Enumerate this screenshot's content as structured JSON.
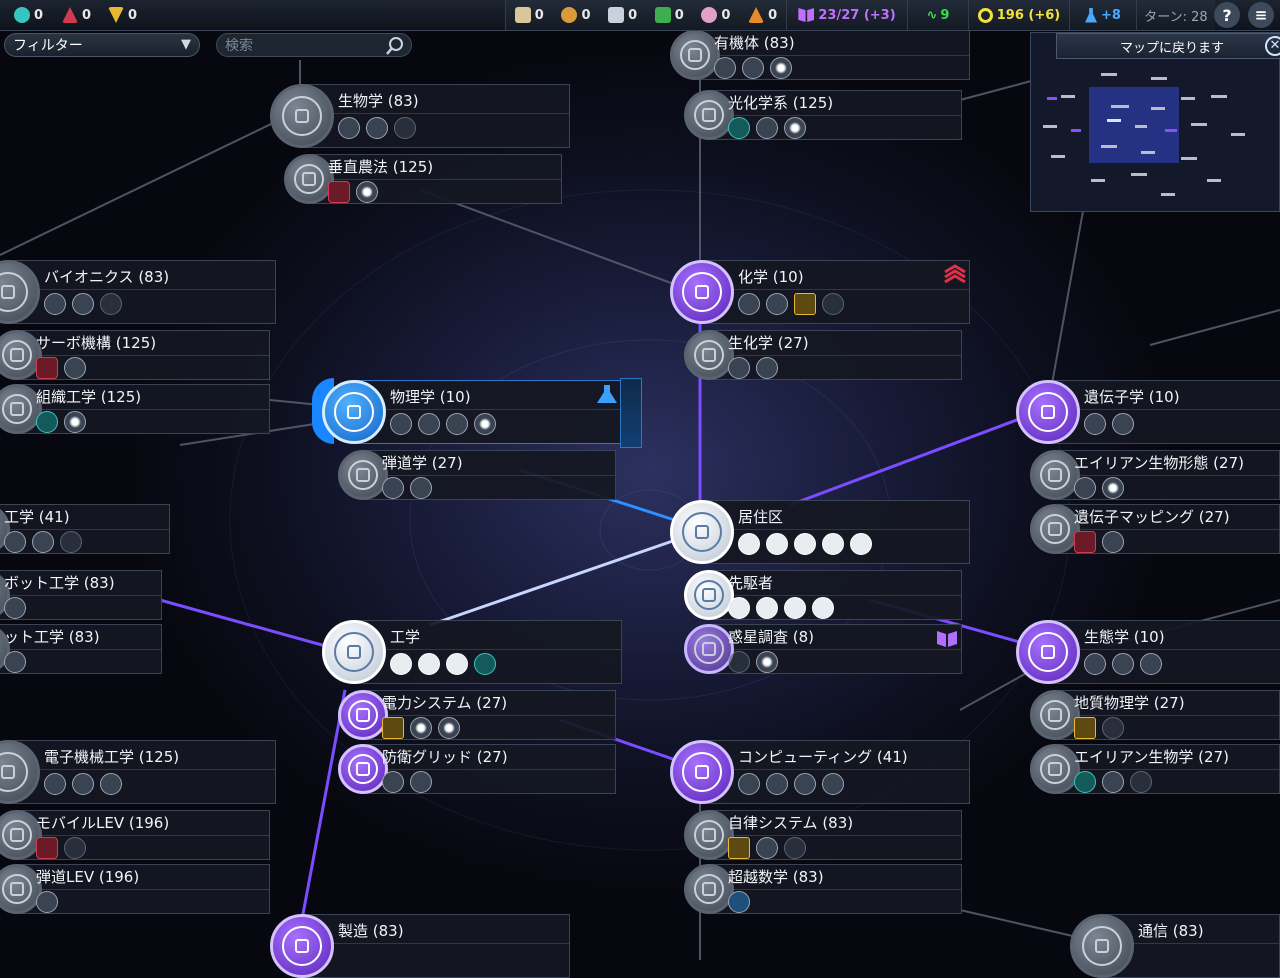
{
  "top_bar": {
    "left_resources": [
      {
        "icon": "teal-resource-icon",
        "value": "0",
        "color": "#36c6c1"
      },
      {
        "icon": "red-resource-icon",
        "value": "0",
        "color": "#d23a52"
      },
      {
        "icon": "gold-resource-icon",
        "value": "0",
        "color": "#e8b832"
      }
    ],
    "strategic_resources": [
      {
        "icon": "firaxite-icon",
        "value": "0"
      },
      {
        "icon": "floatstone-icon",
        "value": "0"
      },
      {
        "icon": "titanium-icon",
        "value": "0"
      },
      {
        "icon": "geothermal-icon",
        "value": "0"
      },
      {
        "icon": "xenomass-icon",
        "value": "0"
      },
      {
        "icon": "oil-icon",
        "value": "0"
      }
    ],
    "science": "23/27 (+3)",
    "health": "9",
    "energy": "196 (+6)",
    "culture": "+8",
    "turn": "ターン: 28",
    "help": "?",
    "menu": "≡"
  },
  "filter": {
    "label": "フィルター"
  },
  "search": {
    "placeholder": "検索"
  },
  "minimap": {
    "title": "マップに戻ります"
  },
  "techs": {
    "organic": {
      "name": "有機体 (83)"
    },
    "photochem": {
      "name": "光化学系 (125)"
    },
    "biology": {
      "name": "生物学 (83)"
    },
    "vertical_farming": {
      "name": "垂直農法 (125)"
    },
    "bionics": {
      "name": "バイオニクス (83)"
    },
    "servo": {
      "name": "サーボ機構 (125)"
    },
    "tissue": {
      "name": "組織工学 (125)"
    },
    "chemistry": {
      "name": "化学 (10)"
    },
    "biochem": {
      "name": "生化学 (27)"
    },
    "physics": {
      "name": "物理学 (10)"
    },
    "ballistics": {
      "name": "弾道学 (27)"
    },
    "genetics": {
      "name": "遺伝子学 (10)"
    },
    "alien_morph": {
      "name": "エイリアン生物形態 (27)"
    },
    "genome": {
      "name": "遺伝子マッピング (27)"
    },
    "x_eng": {
      "name": "工学 (41)"
    },
    "robotics": {
      "name": "ボット工学 (83)"
    },
    "robotics2": {
      "name": "ット工学 (83)"
    },
    "habitation": {
      "name": "居住区"
    },
    "pioneer": {
      "name": "先駆者"
    },
    "planet_survey": {
      "name": "惑星調査 (8)"
    },
    "engineering": {
      "name": "工学"
    },
    "power": {
      "name": "電力システム (27)"
    },
    "defense_grid": {
      "name": "防衛グリッド (27)"
    },
    "ecology": {
      "name": "生態学 (10)"
    },
    "geophysics": {
      "name": "地質物理学 (27)"
    },
    "alien_bio": {
      "name": "エイリアン生物学 (27)"
    },
    "computing": {
      "name": "コンピューティング (41)"
    },
    "autonomy": {
      "name": "自律システム (83)"
    },
    "transcend": {
      "name": "超越数学 (83)"
    },
    "electromech": {
      "name": "電子機械工学 (125)"
    },
    "mobile_lev": {
      "name": "モバイルLEV (196)"
    },
    "ballistic_lev": {
      "name": "弾道LEV (196)"
    },
    "manufacturing": {
      "name": "製造 (83)"
    },
    "comms": {
      "name": "通信 (83)"
    }
  },
  "colors": {
    "accent_purple": "#8a4dff",
    "accent_blue": "#1a86ff",
    "science": "#c070ff",
    "health": "#3ddc4a",
    "energy": "#f3e23a",
    "culture": "#4aa8ff"
  }
}
